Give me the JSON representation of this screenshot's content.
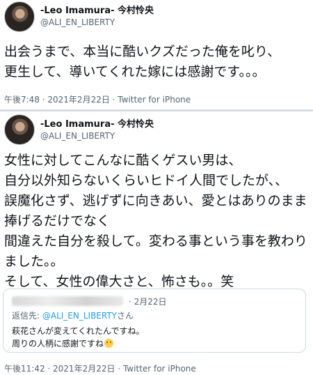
{
  "tweets": [
    {
      "display_name": "-Leo Imamura- 今村怜央",
      "handle": "@ALI_EN_LIBERTY",
      "text": "出会うまで、本当に酷いクズだった俺を叱り、\n更生して、導いてくれた嫁には感謝です。。。",
      "timestamp": "午後7:48 · 2021年2月22日",
      "source": "Twitter for iPhone"
    },
    {
      "display_name": "-Leo Imamura- 今村怜央",
      "handle": "@ALI_EN_LIBERTY",
      "text": "女性に対してこんなに酷くゲスい男は、\n自分以外知らないくらいヒドイ人間でしたが、、\n誤魔化さず、逃げずに向きあい、愛とはありのまま捧げるだけでなく\n間違えた自分を殺して。変わる事という事を教わりました。。\nそして、女性の偉大さと、怖さも。。笑",
      "timestamp": "午後11:42 · 2021年2月22日",
      "source": "Twitter for iPhone",
      "quoted": {
        "date": "· 2月22日",
        "reply_prefix": "返信先: ",
        "reply_handle": "@ALI_EN_LIBERTY",
        "reply_suffix": "さん",
        "text": "萩花さんが変えてくれたんですね。\n周りの人柄に感謝ですね"
      }
    }
  ],
  "icons": {
    "avatar": "profile-photo",
    "emoji": "smiling-face-emoji"
  },
  "colors": {
    "handle_gray": "#536471",
    "link_blue": "#1d9bf0",
    "text": "#0f1419",
    "border": "#cfd9de"
  }
}
